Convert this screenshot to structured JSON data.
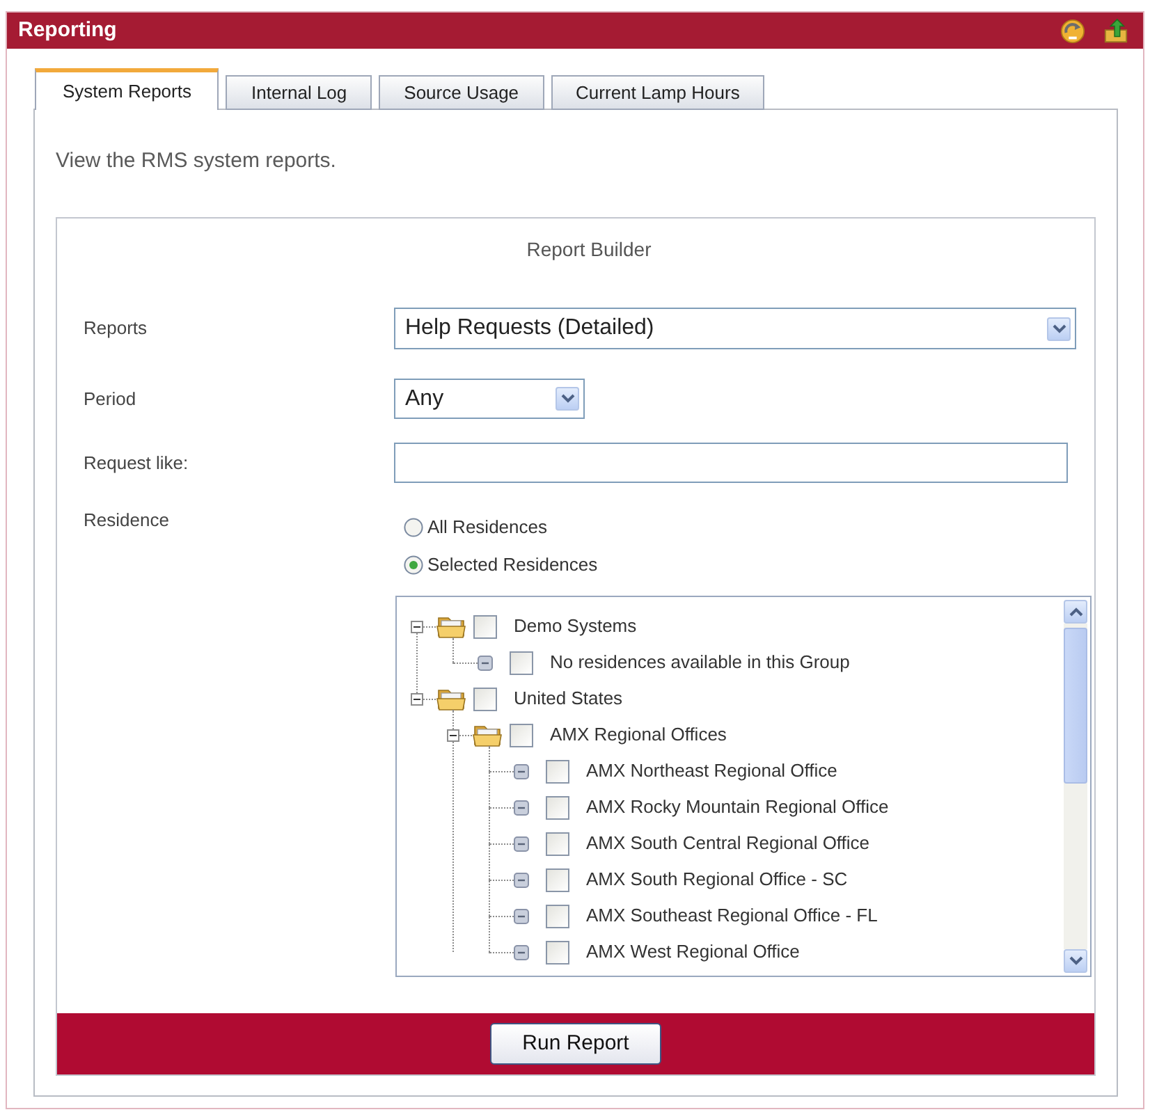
{
  "window": {
    "title": "Reporting"
  },
  "tabs": [
    {
      "label": "System Reports",
      "selected": true
    },
    {
      "label": "Internal Log",
      "selected": false
    },
    {
      "label": "Source Usage",
      "selected": false
    },
    {
      "label": "Current Lamp Hours",
      "selected": false
    }
  ],
  "description": "View the RMS system reports.",
  "report_builder": {
    "title": "Report Builder",
    "reports": {
      "label": "Reports",
      "value": "Help Requests (Detailed)"
    },
    "period": {
      "label": "Period",
      "value": "Any"
    },
    "request_like": {
      "label": "Request like:"
    },
    "residence": {
      "label": "Residence",
      "options": [
        {
          "label": "All Residences",
          "selected": false
        },
        {
          "label": "Selected Residences",
          "selected": true
        }
      ],
      "tree": [
        {
          "kind": "group",
          "label": "Demo Systems",
          "expanded": true,
          "checked": false,
          "children": [
            {
              "kind": "leaf",
              "label": "No residences available in this Group",
              "checked": false
            }
          ]
        },
        {
          "kind": "group",
          "label": "United States",
          "expanded": true,
          "checked": false,
          "children": [
            {
              "kind": "group",
              "label": "AMX Regional Offices",
              "expanded": true,
              "checked": false,
              "children": [
                {
                  "kind": "leaf",
                  "label": "AMX Northeast Regional Office",
                  "checked": false
                },
                {
                  "kind": "leaf",
                  "label": "AMX Rocky Mountain Regional Office",
                  "checked": false
                },
                {
                  "kind": "leaf",
                  "label": "AMX South Central Regional Office",
                  "checked": false
                },
                {
                  "kind": "leaf",
                  "label": "AMX South Regional Office - SC",
                  "checked": false
                },
                {
                  "kind": "leaf",
                  "label": "AMX Southeast Regional Office - FL",
                  "checked": false
                },
                {
                  "kind": "leaf",
                  "label": "AMX West Regional Office",
                  "checked": false
                }
              ]
            }
          ]
        }
      ]
    },
    "run_button": "Run Report"
  }
}
